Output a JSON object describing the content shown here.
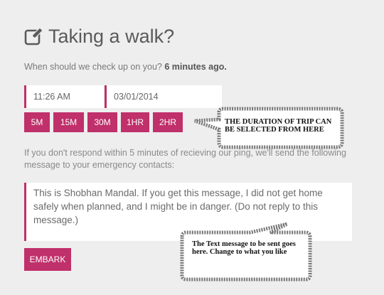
{
  "header": {
    "title": "Taking a walk?",
    "icon": "edit-icon"
  },
  "checkup": {
    "question": "When should we check up on you?",
    "relative_time": "6 minutes ago."
  },
  "time_field": {
    "value": "11:26 AM"
  },
  "date_field": {
    "value": "03/01/2014"
  },
  "durations": [
    "5M",
    "15M",
    "30M",
    "1HR",
    "2HR"
  ],
  "info_text": "If you don't respond within 5 minutes of recieving our ping, we'll send the following message to your emergency contacts:",
  "message": {
    "text": "This is Shobhan Mandal. If you get this message, I did not get home safely when planned, and I might be in danger. (Do not reply to this message.)"
  },
  "embark_label": "EMBARK",
  "annotations": {
    "duration_callout": "THE DURATION OF TRIP CAN BE SELECTED FROM HERE",
    "message_callout": "The Text message to be sent goes here. Change to what you like"
  },
  "colors": {
    "accent": "#c0306a",
    "background": "#eeeeee"
  }
}
